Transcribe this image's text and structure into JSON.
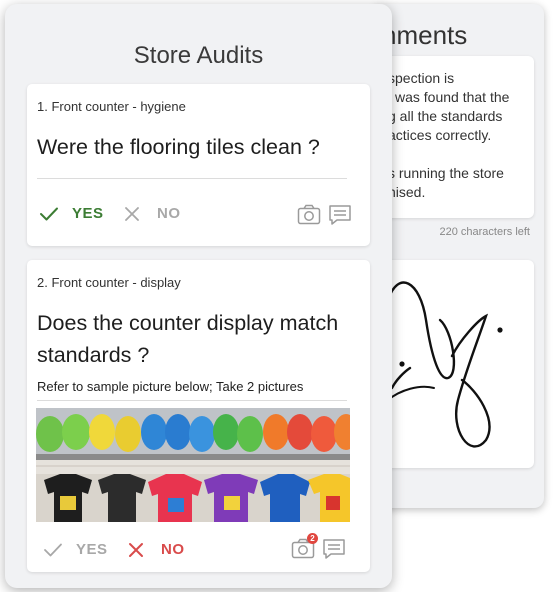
{
  "back_card": {
    "title": "nments",
    "comment_lines": [
      "spection is",
      "l was found that the",
      "g all the standards",
      "actices correctly.",
      "",
      "s running the store",
      "nised."
    ],
    "char_count": "220 characters left"
  },
  "front_card": {
    "title": "Store Audits",
    "questions": [
      {
        "label": "1.  Front counter - hygiene",
        "text_lines": [
          "Were the flooring tiles clean ?"
        ],
        "yes_label": "YES",
        "no_label": "NO",
        "selected": "yes"
      },
      {
        "label": "2.  Front counter - display",
        "text_lines": [
          "Does the counter display match",
          "standards ?"
        ],
        "hint": "Refer to sample picture below;  Take 2 pictures",
        "yes_label": "YES",
        "no_label": "NO",
        "selected": "no",
        "photo_badge": "2"
      }
    ]
  },
  "colors": {
    "yes_active": "#3c7d34",
    "no_active": "#d94b4b",
    "inactive": "#a8a8a8"
  }
}
